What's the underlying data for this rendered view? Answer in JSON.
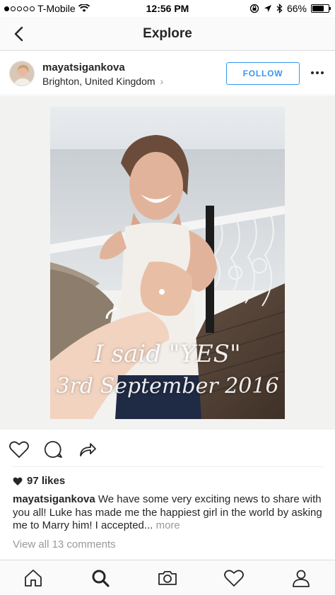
{
  "status_bar": {
    "carrier": "T-Mobile",
    "time": "12:56 PM",
    "battery": "66%",
    "battery_level": 0.66,
    "signal_bars_filled": 1,
    "signal_bars_total": 5
  },
  "nav": {
    "title": "Explore",
    "back_icon": "chevron-left-icon"
  },
  "post": {
    "username": "mayatsigankova",
    "location": "Brighton, United Kingdom",
    "location_chevron": "›",
    "follow_label": "FOLLOW",
    "photo_text_line1": "I said \"YES\"",
    "photo_text_line2": "3rd September 2016",
    "likes": "97 likes",
    "caption_username": "mayatsigankova",
    "caption_text": " We have some very exciting news to share with you all! Luke has made me the happiest girl in the world by asking me to Marry him! I accepted...",
    "caption_more": " more",
    "view_comments": "View all 13 comments"
  },
  "actions": [
    "heart-icon",
    "comment-icon",
    "share-icon"
  ],
  "tabs": [
    "home-icon",
    "search-icon",
    "camera-icon",
    "activity-heart-icon",
    "profile-icon"
  ],
  "colors": {
    "accent": "#3897f0",
    "text": "#262626",
    "muted": "#999999",
    "nav_bg": "#fafafa"
  }
}
